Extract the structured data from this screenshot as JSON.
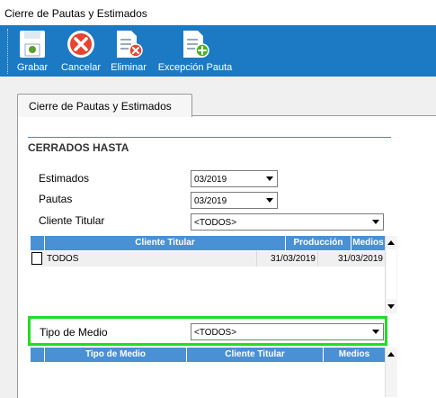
{
  "window": {
    "title": "Cierre de Pautas y Estimados"
  },
  "toolbar": {
    "buttons": [
      {
        "label": "Grabar",
        "icon": "save-icon"
      },
      {
        "label": "Cancelar",
        "icon": "cancel-icon"
      },
      {
        "label": "Eliminar",
        "icon": "delete-document-icon"
      },
      {
        "label": "Excepción Pauta",
        "icon": "add-document-icon"
      }
    ]
  },
  "tab": {
    "label": "Cierre de Pautas y Estimados"
  },
  "section": {
    "title": "CERRADOS HASTA"
  },
  "form": {
    "estimados": {
      "label": "Estimados",
      "value": "03/2019"
    },
    "pautas": {
      "label": "Pautas",
      "value": "03/2019"
    },
    "cliente_titular": {
      "label": "Cliente Titular",
      "value": "<TODOS>"
    },
    "tipo_medio": {
      "label": "Tipo de Medio",
      "value": "<TODOS>"
    }
  },
  "grid1": {
    "columns": [
      "Cliente Titular",
      "Producción",
      "Medios"
    ],
    "rows": [
      {
        "cliente": "TODOS",
        "produccion": "31/03/2019",
        "medios": "31/03/2019"
      }
    ]
  },
  "grid2": {
    "columns": [
      "Tipo de Medio",
      "Cliente Titular",
      "Medios"
    ]
  },
  "colors": {
    "toolbar": "#1b7ac3",
    "header": "#4a90d4",
    "highlight": "#22dd22"
  }
}
